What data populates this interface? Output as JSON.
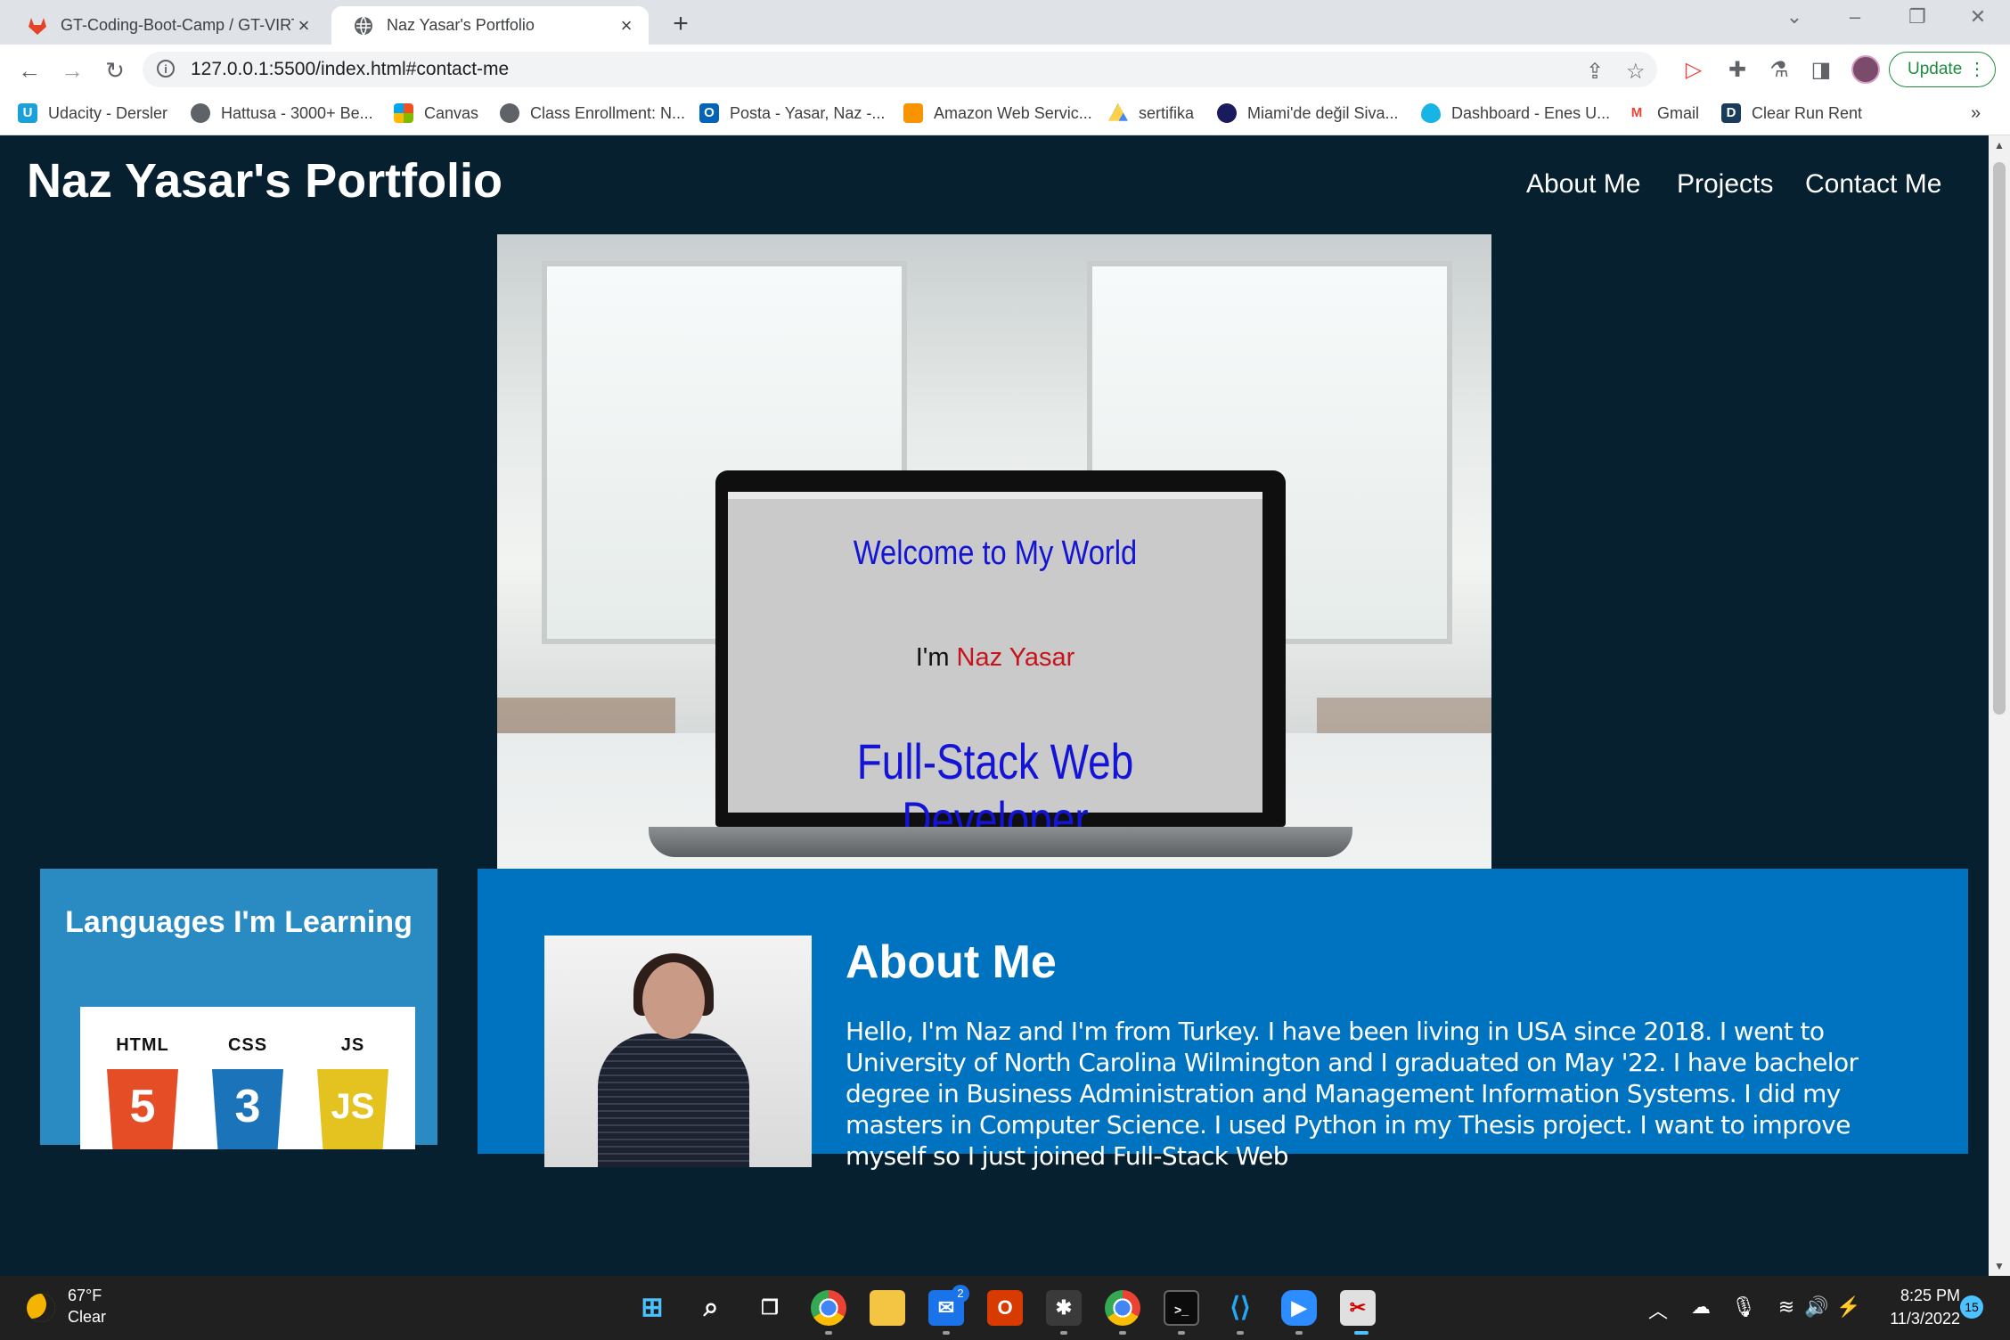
{
  "browser": {
    "tabs": [
      {
        "title": "GT-Coding-Boot-Camp / GT-VIRT"
      },
      {
        "title": "Naz Yasar's Portfolio"
      }
    ],
    "url": "127.0.0.1:5500/index.html#contact-me",
    "update_label": "Update",
    "bookmarks": [
      {
        "label": "Udacity - Dersler",
        "color": "#1aa1d9"
      },
      {
        "label": "Hattusa - 3000+ Be...",
        "color": "#5f6368"
      },
      {
        "label": "Canvas",
        "color": "#f25022"
      },
      {
        "label": "Class Enrollment: N...",
        "color": "#5f6368"
      },
      {
        "label": "Posta - Yasar, Naz -...",
        "color": "#0364b8"
      },
      {
        "label": "Amazon Web Servic...",
        "color": "#f79400"
      },
      {
        "label": "sertifika",
        "color": "#1fa463"
      },
      {
        "label": "Miami'de değil Siva...",
        "color": "#1a1a5e"
      },
      {
        "label": "Dashboard - Enes U...",
        "color": "#19b4e6"
      },
      {
        "label": "Gmail",
        "color": "#ea4335"
      },
      {
        "label": "Clear Run Rent",
        "color": "#1a3c5c"
      }
    ]
  },
  "page": {
    "title": "Naz Yasar's Portfolio",
    "nav": [
      "About Me",
      "Projects",
      "Contact Me"
    ],
    "hero": {
      "welcome": "Welcome to My World",
      "im": "I'm",
      "name": "Naz Yasar",
      "role": "Full-Stack Web Developer"
    },
    "languages": {
      "title": "Languages I'm Learning",
      "badges": [
        {
          "label": "HTML",
          "number": "5",
          "color": "#e44d26"
        },
        {
          "label": "CSS",
          "number": "3",
          "color": "#1b73ba"
        },
        {
          "label": "JS",
          "number": "JS",
          "color": "#e4c21f"
        }
      ]
    },
    "about": {
      "heading": "About Me",
      "text": "Hello, I'm Naz and I'm from Turkey. I have been living in USA since 2018. I went to University of North Carolina Wilmington and I graduated on May '22. I have bachelor degree in Business Administration and Management Information Systems. I did my masters in Computer Science. I used Python in my Thesis project. I want to improve myself so I just joined Full-Stack Web"
    }
  },
  "taskbar": {
    "weather_temp": "67°F",
    "weather_desc": "Clear",
    "mail_badge": "2",
    "time": "8:25 PM",
    "date": "11/3/2022",
    "notifications": "15"
  }
}
